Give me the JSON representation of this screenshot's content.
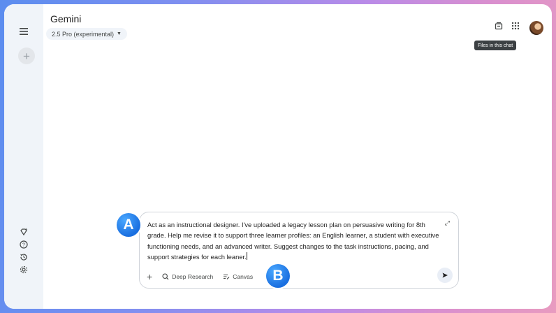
{
  "header": {
    "title": "Gemini",
    "model_label": "2.5 Pro (experimental)"
  },
  "tooltip": "Files in this chat",
  "composer": {
    "prompt_text": "Act as an instructional designer. I've uploaded a legacy lesson plan on persuasive writing for 8th grade. Help me revise it to support three learner profiles: an English learner, a student with executive functioning needs, and an advanced writer. Suggest changes to the task instructions, pacing, and support strategies for each leaner.",
    "tools": {
      "add": "+",
      "deep_research": "Deep Research",
      "canvas": "Canvas"
    }
  },
  "callouts": {
    "a": "A",
    "b": "B"
  },
  "icons": {
    "menu": "menu-icon",
    "new_chat": "plus-icon",
    "gems": "gem-icon",
    "help": "help-icon",
    "activity": "history-icon",
    "settings": "gear-icon",
    "files": "files-icon",
    "apps": "apps-grid-icon",
    "send": "send-icon"
  },
  "colors": {
    "accent_blue": "#1a6fe0",
    "sidebar_bg": "#f0f4f9",
    "border_gradient_start": "#5b8def",
    "border_gradient_end": "#e89bc0"
  }
}
